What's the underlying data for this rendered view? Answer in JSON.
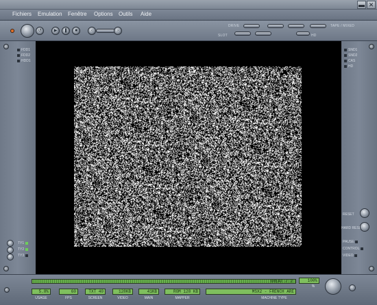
{
  "window": {
    "minimize_icon": "minimize-icon",
    "close_glyph": "✕"
  },
  "menu": [
    "Fichiers",
    "Emulation",
    "Fenêtre",
    "Options",
    "Outils",
    "Aide"
  ],
  "toolbar": {
    "drive_label": "DRIVE",
    "slot_label": "SLOT",
    "tape_label": "TAPE / MIXED",
    "hd_label": "HD"
  },
  "left_panel": {
    "top_leds": [
      "FDD1",
      "FDD2",
      "HDD1"
    ],
    "bottom_leds": [
      "TY1",
      "TY2",
      "TY3"
    ]
  },
  "right_panel": {
    "top_leds": [
      "SND1",
      "SND2",
      "CAS",
      "HD"
    ],
    "buttons": [
      "RESET",
      "HARD RESET"
    ],
    "indicators": [
      "PAUSE",
      "CONTROL",
      "VIDEO"
    ]
  },
  "status": {
    "meter_left": "",
    "meter_right": "GREAT / 2",
    "percent": "100%",
    "percent_unit": "%",
    "fields": [
      {
        "value": "5.8%",
        "label": "USAGE"
      },
      {
        "value": "60",
        "label": "FPS"
      },
      {
        "value": "TXT 40",
        "label": "SCREEN"
      },
      {
        "value": "128KB",
        "label": "VIDEO"
      },
      {
        "value": "41KB",
        "label": "MAIN"
      },
      {
        "value": "ROM 128 KB",
        "label": "MAPPER"
      },
      {
        "value": "MSX2 - FRENCH ARE",
        "label": "MACHINE TYPE"
      }
    ]
  },
  "colors": {
    "lcd_green": "#7fbf5e",
    "led_on": "#6dce5a",
    "screen_bg": "#000000"
  }
}
